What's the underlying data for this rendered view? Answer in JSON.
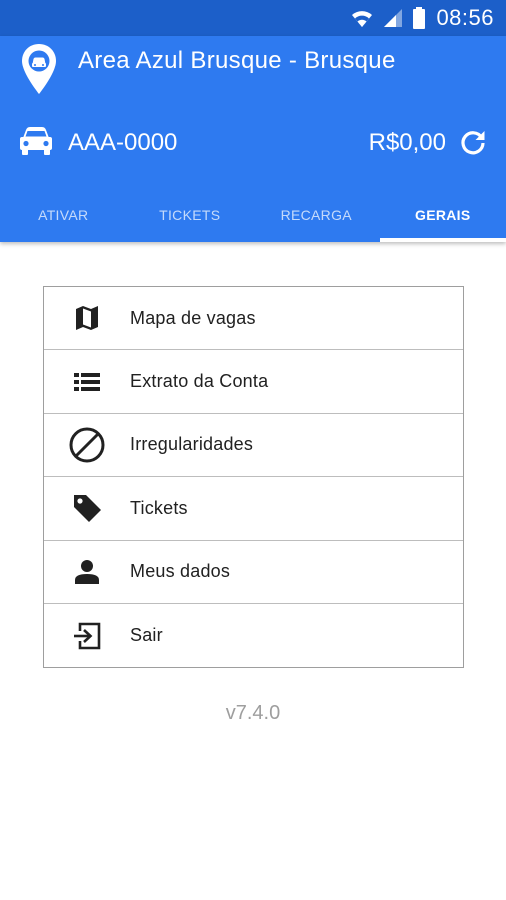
{
  "status_bar": {
    "time": "08:56",
    "icons": [
      "wifi-icon",
      "signal-icon",
      "battery-icon"
    ]
  },
  "header": {
    "location_icon": "map-pin-car-icon",
    "location_title": "Area Azul Brusque - Brusque",
    "vehicle_icon": "car-icon",
    "plate": "AAA-0000",
    "balance": "R$0,00",
    "refresh_icon": "refresh-icon",
    "accent_color": "#2e7af0",
    "status_color": "#1c5fc9"
  },
  "tabs": [
    {
      "label": "ATIVAR",
      "active": false
    },
    {
      "label": "TICKETS",
      "active": false
    },
    {
      "label": "RECARGA",
      "active": false
    },
    {
      "label": "GERAIS",
      "active": true
    }
  ],
  "menu": [
    {
      "label": "Mapa de vagas",
      "icon": "map-icon"
    },
    {
      "label": "Extrato da Conta",
      "icon": "list-icon"
    },
    {
      "label": "Irregularidades",
      "icon": "block-icon"
    },
    {
      "label": "Tickets",
      "icon": "tag-icon"
    },
    {
      "label": "Meus dados",
      "icon": "person-icon"
    },
    {
      "label": "Sair",
      "icon": "exit-icon"
    }
  ],
  "version": "v7.4.0"
}
